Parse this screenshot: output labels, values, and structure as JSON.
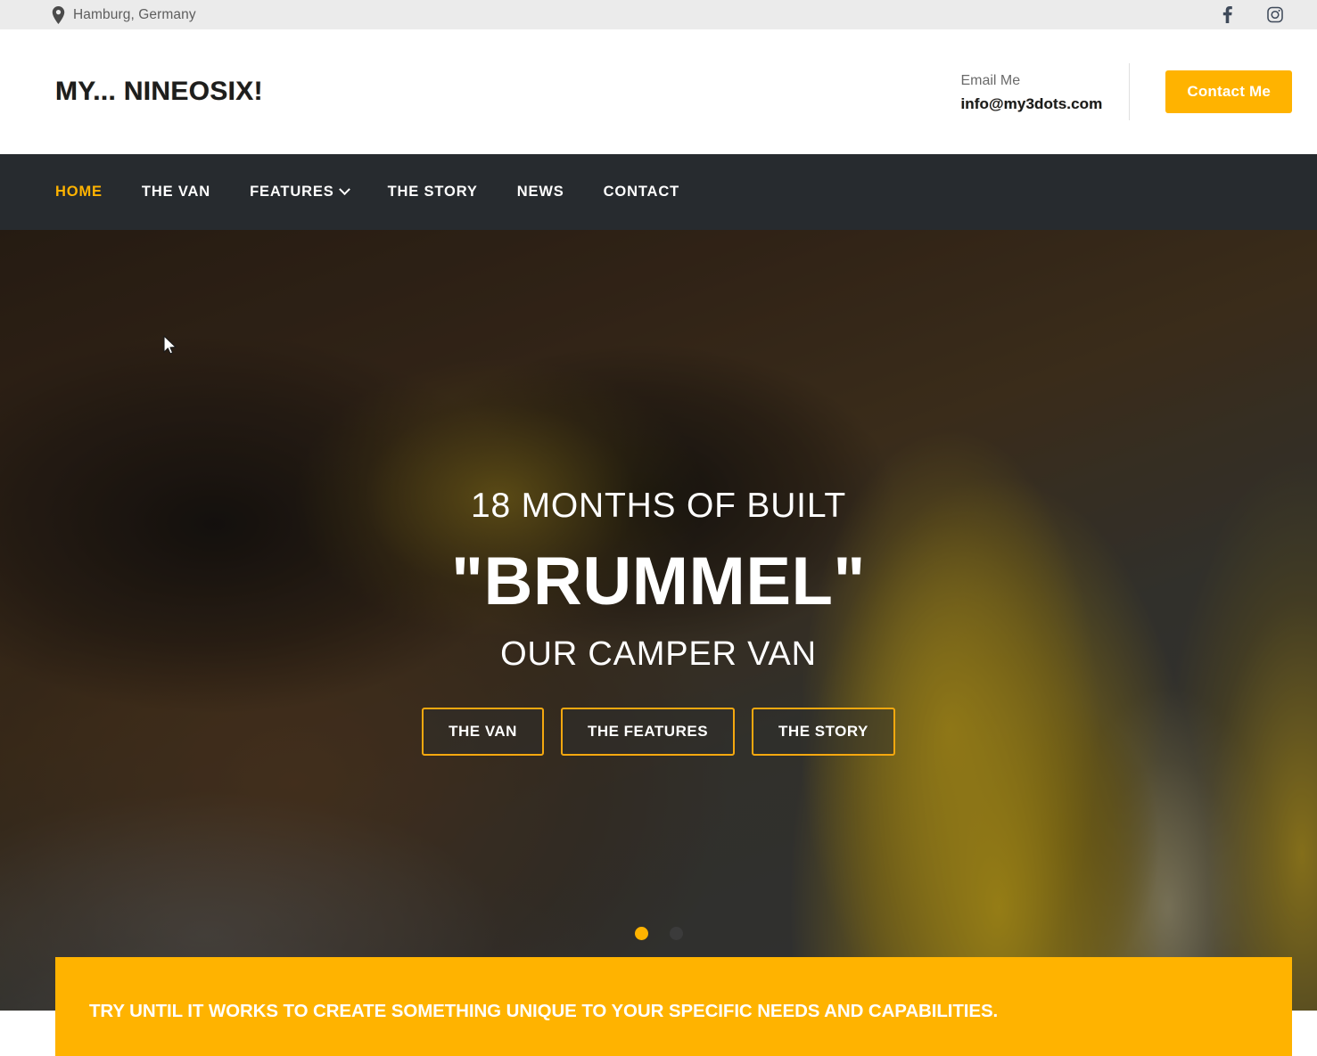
{
  "topbar": {
    "location": "Hamburg, Germany",
    "social": [
      {
        "name": "facebook-icon",
        "glyph": "f"
      },
      {
        "name": "instagram-icon",
        "glyph": ""
      }
    ]
  },
  "header": {
    "logo": "MY... NINEOSIX!",
    "email_label": "Email Me",
    "email_value": "info@my3dots.com",
    "contact_button": "Contact Me"
  },
  "nav": {
    "items": [
      {
        "label": "HOME",
        "active": true,
        "dropdown": false
      },
      {
        "label": "THE VAN",
        "active": false,
        "dropdown": false
      },
      {
        "label": "FEATURES",
        "active": false,
        "dropdown": true
      },
      {
        "label": "THE STORY",
        "active": false,
        "dropdown": false
      },
      {
        "label": "NEWS",
        "active": false,
        "dropdown": false
      },
      {
        "label": "CONTACT",
        "active": false,
        "dropdown": false
      }
    ]
  },
  "hero": {
    "eyebrow": "18 MONTHS OF BUILT",
    "title": "\"BRUMMEL\"",
    "subtitle": "OUR CAMPER VAN",
    "buttons": [
      {
        "label": "THE VAN"
      },
      {
        "label": "THE FEATURES"
      },
      {
        "label": "THE STORY"
      }
    ],
    "carousel": {
      "slides": 2,
      "active_index": 0
    }
  },
  "banner": {
    "text": "TRY UNTIL IT WORKS TO CREATE SOMETHING UNIQUE TO YOUR SPECIFIC NEEDS AND CAPABILITIES."
  },
  "colors": {
    "accent": "#ffb300",
    "nav_background": "#272b2f",
    "topbar_background": "#ebebeb",
    "hero_button_border": "#f5a80f"
  }
}
